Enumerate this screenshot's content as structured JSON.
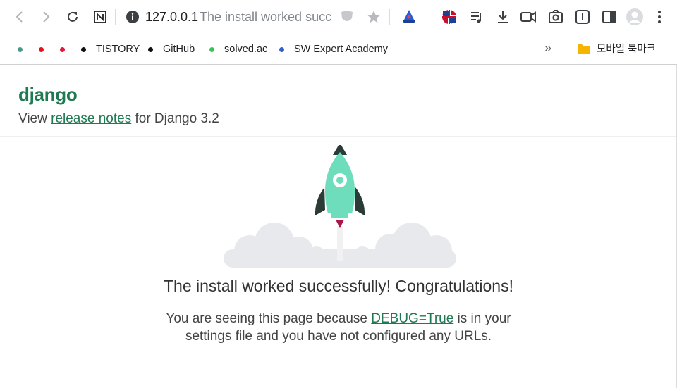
{
  "toolbar": {
    "back_icon": "chevron-left-icon",
    "forward_icon": "chevron-right-icon",
    "reload_icon": "reload-icon",
    "notion_icon": "notion-icon",
    "info_icon": "info-icon",
    "url_host": "127.0.0.1",
    "url_title": "The install worked succ",
    "profile_icon": "avatar-icon"
  },
  "bookmarks": {
    "items": [
      {
        "label": "",
        "color": "#4a9a8a"
      },
      {
        "label": "",
        "color": "#e8121f"
      },
      {
        "label": "",
        "color": "#e5153c"
      },
      {
        "label": "TISTORY",
        "color": "#111111"
      },
      {
        "label": "GitHub",
        "color": "#111111"
      },
      {
        "label": "solved.ac",
        "color": "#3cc25b"
      },
      {
        "label": "SW Expert Academy",
        "color": "#2f62c7"
      }
    ],
    "more": "»",
    "folder": "모바일 북마크"
  },
  "page": {
    "logo": "django",
    "release_prefix": "View ",
    "release_link": "release notes",
    "release_suffix": " for Django 3.2",
    "congrats": "The install worked successfully! Congratulations!",
    "desc_prefix": "You are seeing this page because ",
    "desc_link": "DEBUG=True",
    "desc_suffix": " is in your settings file and you have not configured any URLs."
  },
  "colors": {
    "django_green": "#1f7a52",
    "rocket_body": "#6dddbc",
    "rocket_fin": "#2b3b36",
    "cloud": "#e8e9ec"
  }
}
